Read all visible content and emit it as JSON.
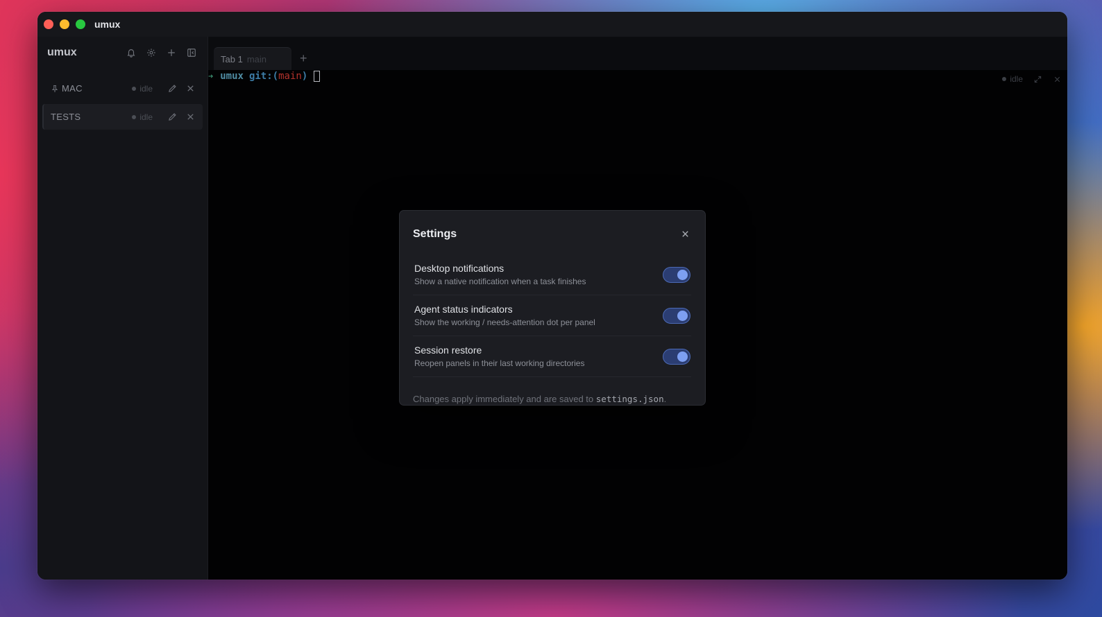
{
  "window": {
    "title": "umux"
  },
  "sidebar": {
    "brand": "umux",
    "workspaces": [
      {
        "name": "MAC",
        "status": "idle",
        "pinned": true,
        "active": false
      },
      {
        "name": "TESTS",
        "status": "idle",
        "pinned": false,
        "active": true
      }
    ]
  },
  "tabs": [
    {
      "label": "Tab 1",
      "branch": "main"
    }
  ],
  "terminal": {
    "arrow": "➜",
    "dir": "umux",
    "git_prefix": "git:(",
    "branch": "main",
    "git_suffix": ")",
    "pane_status": "idle"
  },
  "settings": {
    "title": "Settings",
    "items": [
      {
        "title": "Desktop notifications",
        "description": "Show a native notification when a task finishes",
        "enabled": true
      },
      {
        "title": "Agent status indicators",
        "description": "Show the working / needs-attention dot per panel",
        "enabled": true
      },
      {
        "title": "Session restore",
        "description": "Reopen panels in their last working directories",
        "enabled": true
      }
    ],
    "footer_prefix": "Changes apply immediately and are saved to ",
    "footer_file": "settings.json",
    "footer_suffix": "."
  },
  "colors": {
    "accent": "#7d9ff2",
    "toggle_track": "#2b3d72",
    "branch_red": "#b2322c"
  }
}
